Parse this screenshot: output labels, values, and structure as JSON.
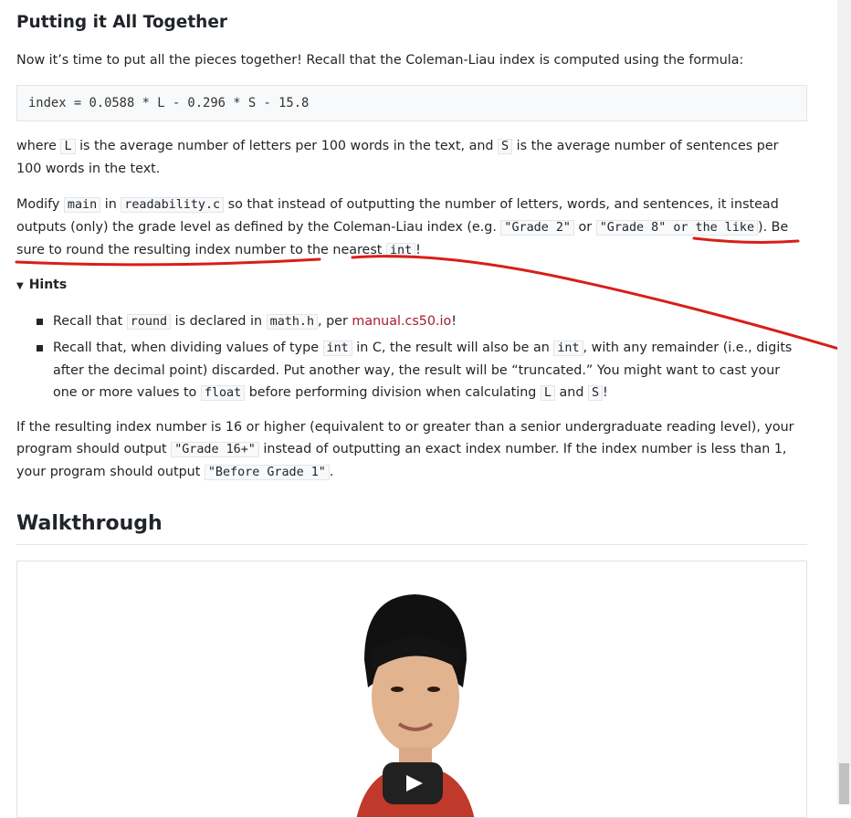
{
  "section_title": "Putting it All Together",
  "intro": "Now it’s time to put all the pieces together! Recall that the Coleman-Liau index is computed using the formula:",
  "formula": "index = 0.0588 * L - 0.296 * S - 15.8",
  "where": {
    "t1": "where ",
    "c1": "L",
    "t2": " is the average number of letters per 100 words in the text, and ",
    "c2": "S",
    "t3": " is the average number of sentences per 100 words in the text."
  },
  "modify": {
    "t1": "Modify ",
    "c1": "main",
    "t2": " in ",
    "c2": "readability.c",
    "t3": " so that instead of outputting the number of letters, words, and sentences, it instead outputs (only) the grade level as defined by the Coleman-Liau index (e.g. ",
    "c3": "\"Grade 2\"",
    "t4": " or ",
    "c4": "\"Grade 8\" or the like",
    "t5": "). Be sure to round the resulting index number to the nearest ",
    "c5": "int",
    "t6": "!"
  },
  "hints": {
    "label": "Hints",
    "h1": {
      "t1": "Recall that ",
      "c1": "round",
      "t2": " is declared in ",
      "c2": "math.h",
      "t3": ", per ",
      "link": "manual.cs50.io",
      "t4": "!"
    },
    "h2": {
      "t1": "Recall that, when dividing values of type ",
      "c1": "int",
      "t2": " in C, the result will also be an ",
      "c2": "int",
      "t3": ", with any remainder (i.e., digits after the decimal point) discarded. Put another way, the result will be “truncated.” You might want to cast your one or more values to ",
      "c3": "float",
      "t4": " before performing division when calculating ",
      "c4": "L",
      "t5": " and ",
      "c5": "S",
      "t6": "!"
    }
  },
  "result": {
    "t1": "If the resulting index number is 16 or higher (equivalent to or greater than a senior undergraduate reading level), your program should output ",
    "c1": "\"Grade 16+\"",
    "t2": " instead of outputting an exact index number. If the index number is less than 1, your program should output ",
    "c2": "\"Before Grade 1\"",
    "t3": "."
  },
  "walkthrough_title": "Walkthrough",
  "colors": {
    "link": "#a51c30",
    "annotation": "#d91e18",
    "text": "#212529"
  }
}
